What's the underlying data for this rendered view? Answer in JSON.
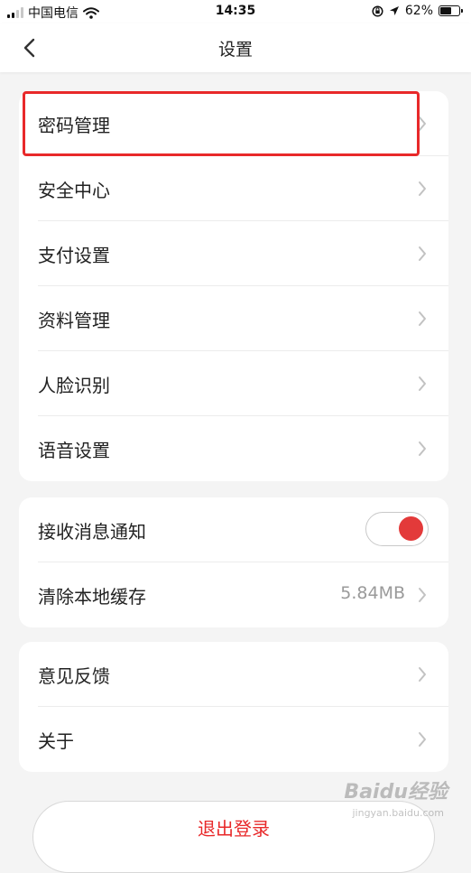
{
  "status_bar": {
    "carrier": "中国电信",
    "time": "14:35",
    "battery": "62%",
    "battery_level": 0.62
  },
  "nav": {
    "title": "设置"
  },
  "group1": [
    {
      "label": "密码管理"
    },
    {
      "label": "安全中心"
    },
    {
      "label": "支付设置"
    },
    {
      "label": "资料管理"
    },
    {
      "label": "人脸识别"
    },
    {
      "label": "语音设置"
    }
  ],
  "group2": {
    "notify_label": "接收消息通知",
    "notify_enabled": true,
    "cache_label": "清除本地缓存",
    "cache_value": "5.84MB"
  },
  "group3": [
    {
      "label": "意见反馈"
    },
    {
      "label": "关于"
    }
  ],
  "logout_label": "退出登录",
  "watermark": {
    "brand": "Baidu经验",
    "url": "jingyan.baidu.com"
  },
  "colors": {
    "accent": "#e8292a",
    "toggle_on": "#e33a3a"
  },
  "icons": [
    "back-chevron-icon",
    "chevron-right-icon",
    "wifi-icon",
    "location-arrow-icon",
    "rotation-lock-icon",
    "battery-icon",
    "signal-icon"
  ]
}
